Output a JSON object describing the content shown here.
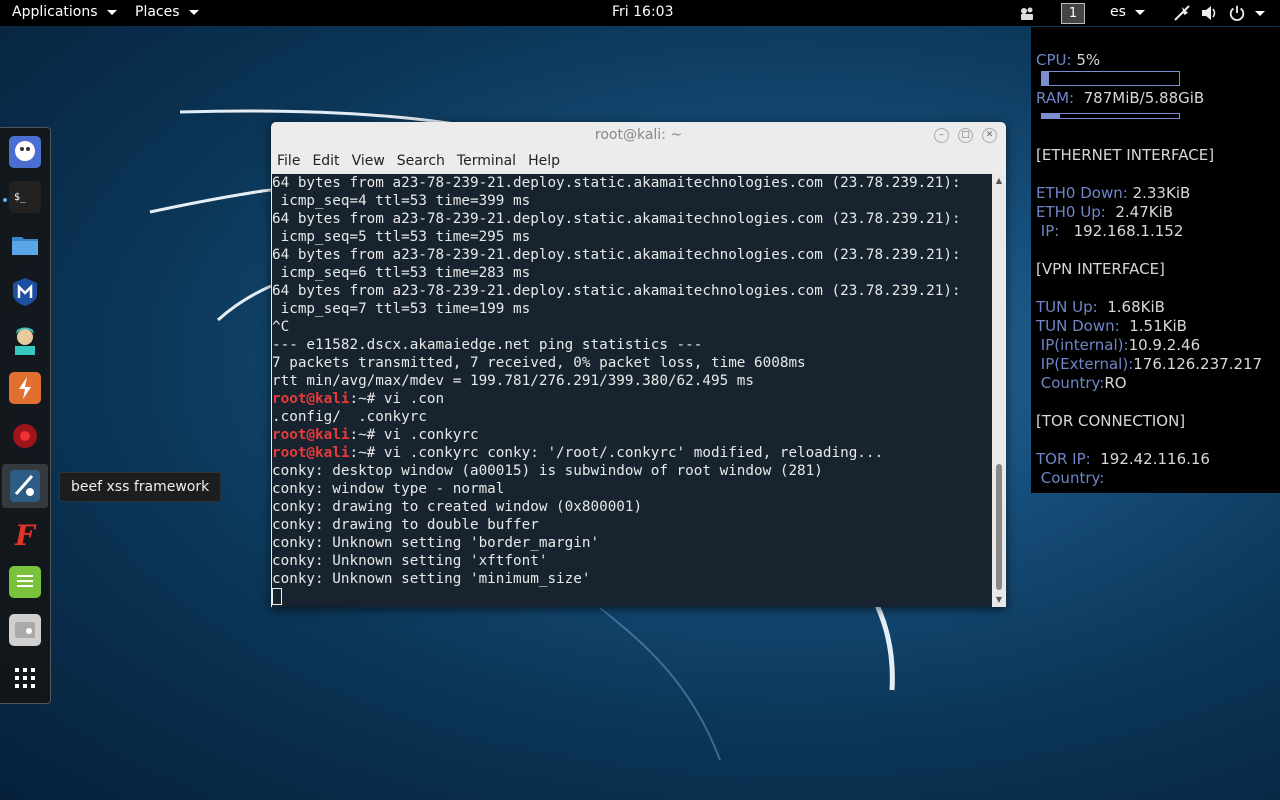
{
  "topbar": {
    "applications": "Applications",
    "places": "Places",
    "clock": "Fri 16:03",
    "workspace": "1",
    "keyboard_layout": "es",
    "icons": [
      "camera-icon",
      "network-icon",
      "volume-icon",
      "power-icon"
    ]
  },
  "dock": {
    "items": [
      "kali-icon",
      "terminal-icon",
      "files-icon",
      "metasploit-icon",
      "armitage-icon",
      "burpsuite-icon",
      "maltego-icon",
      "beef-icon",
      "faraday-icon",
      "leafpad-icon",
      "cherrytree-icon",
      "show-apps-icon"
    ],
    "tooltip": "beef xss framework"
  },
  "terminal": {
    "title": "root@kali: ~",
    "menu": [
      "File",
      "Edit",
      "View",
      "Search",
      "Terminal",
      "Help"
    ],
    "lines": [
      {
        "text": "64 bytes from a23-78-239-21.deploy.static.akamaitechnologies.com (23.78.239.21):"
      },
      {
        "text": " icmp_seq=4 ttl=53 time=399 ms"
      },
      {
        "text": "64 bytes from a23-78-239-21.deploy.static.akamaitechnologies.com (23.78.239.21):"
      },
      {
        "text": " icmp_seq=5 ttl=53 time=295 ms"
      },
      {
        "text": "64 bytes from a23-78-239-21.deploy.static.akamaitechnologies.com (23.78.239.21):"
      },
      {
        "text": " icmp_seq=6 ttl=53 time=283 ms"
      },
      {
        "text": "64 bytes from a23-78-239-21.deploy.static.akamaitechnologies.com (23.78.239.21):"
      },
      {
        "text": " icmp_seq=7 ttl=53 time=199 ms"
      },
      {
        "text": "^C"
      },
      {
        "text": "--- e11582.dscx.akamaiedge.net ping statistics ---"
      },
      {
        "text": "7 packets transmitted, 7 received, 0% packet loss, time 6008ms"
      },
      {
        "text": "rtt min/avg/max/mdev = 199.781/276.291/399.380/62.495 ms"
      },
      {
        "prompt": "root@kali",
        "text": ":~# vi .con"
      },
      {
        "text": ".config/  .conkyrc"
      },
      {
        "prompt": "root@kali",
        "text": ":~# vi .conkyrc"
      },
      {
        "prompt": "root@kali",
        "text": ":~# vi .conkyrc conky: '/root/.conkyrc' modified, reloading..."
      },
      {
        "text": "conky: desktop window (a00015) is subwindow of root window (281)"
      },
      {
        "text": "conky: window type - normal"
      },
      {
        "text": "conky: drawing to created window (0x800001)"
      },
      {
        "text": "conky: drawing to double buffer"
      },
      {
        "text": "conky: Unknown setting 'border_margin'"
      },
      {
        "text": "conky: Unknown setting 'xftfont'"
      },
      {
        "text": "conky: Unknown setting 'minimum_size'"
      }
    ]
  },
  "conky": {
    "cpu_label": "CPU:",
    "cpu_value": "5%",
    "cpu_fraction": 0.05,
    "ram_label": "RAM:",
    "ram_value": "787MiB/5.88GiB",
    "ram_fraction": 0.13,
    "ethernet_header": "[ETHERNET INTERFACE]",
    "eth0_down_label": "ETH0 Down:",
    "eth0_down_value": "2.33KiB",
    "eth0_up_label": "ETH0 Up:",
    "eth0_up_value": "2.47KiB",
    "ip_label": "IP:",
    "ip_value": "192.168.1.152",
    "vpn_header": "[VPN INTERFACE]",
    "tun_up_label": "TUN Up:",
    "tun_up_value": "1.68KiB",
    "tun_down_label": "TUN Down:",
    "tun_down_value": "1.51KiB",
    "ip_internal_label": "IP(internal):",
    "ip_internal_value": "10.9.2.46",
    "ip_external_label": "IP(External):",
    "ip_external_value": "176.126.237.217",
    "country_label": "Country:",
    "country_value": "RO",
    "tor_header": "[TOR CONNECTION]",
    "tor_ip_label": "TOR IP:",
    "tor_ip_value": "192.42.116.16",
    "tor_country_label": "Country:"
  }
}
